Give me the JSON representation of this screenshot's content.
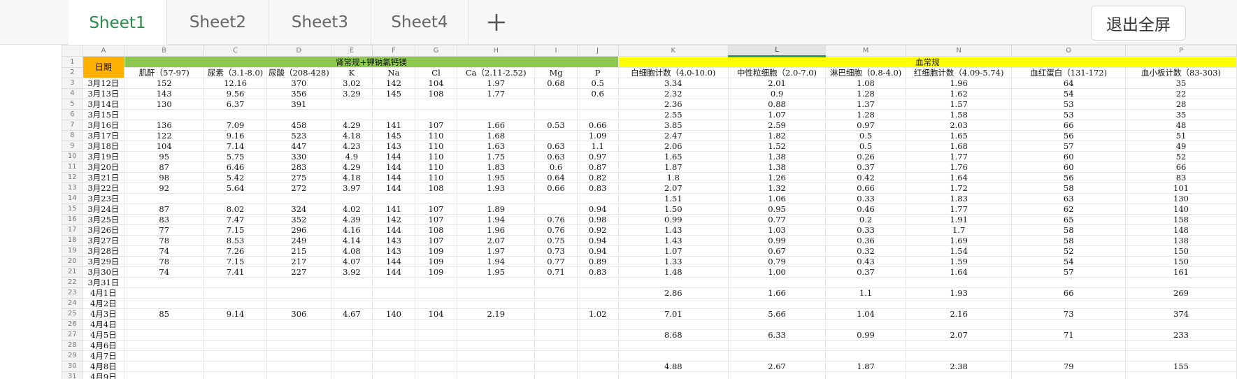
{
  "tabs": [
    {
      "label": "Sheet1",
      "active": true
    },
    {
      "label": "Sheet2",
      "active": false
    },
    {
      "label": "Sheet3",
      "active": false
    },
    {
      "label": "Sheet4",
      "active": false
    }
  ],
  "add_tab_icon": "plus-icon",
  "exit_fullscreen_label": "退出全屏",
  "accent_color": "#2a8a4a",
  "group_colors": {
    "kidney": "#8dc84f",
    "blood": "#ffff00",
    "date": "#ffb000"
  },
  "columns": [
    "A",
    "B",
    "C",
    "D",
    "E",
    "F",
    "G",
    "H",
    "I",
    "J",
    "K",
    "L",
    "M",
    "N",
    "O",
    "P"
  ],
  "selected_column": "L",
  "row1": {
    "date_label": "日期",
    "kidney_group": "肾常规+钾钠氯钙镁",
    "blood_group": "血常规"
  },
  "row2_headers": [
    "肌酐（57-97)",
    "尿素（3.1-8.0)",
    "尿酸（208-428)",
    "K",
    "Na",
    "Cl",
    "Ca（2.11-2.52)",
    "Mg",
    "P",
    "白细胞计数（4.0-10.0)",
    "中性粒细胞（2.0-7.0)",
    "淋巴细胞（0.8-4.0)",
    "红细胞计数（4.09-5.74)",
    "血红蛋白（131-172)",
    "血小板计数（83-303)"
  ],
  "rows": [
    {
      "num": "3",
      "cells": [
        "3月12日",
        "152",
        "12.16",
        "370",
        "3.02",
        "142",
        "104",
        "1.97",
        "0.68",
        "0.5",
        "3.34",
        "2.01",
        "1.08",
        "1.96",
        "64",
        "35"
      ]
    },
    {
      "num": "4",
      "cells": [
        "3月13日",
        "143",
        "9.56",
        "356",
        "3.29",
        "145",
        "108",
        "1.77",
        "",
        "0.6",
        "2.32",
        "0.9",
        "1.28",
        "1.62",
        "54",
        "22"
      ]
    },
    {
      "num": "5",
      "cells": [
        "3月14日",
        "130",
        "6.37",
        "391",
        "",
        "",
        "",
        "",
        "",
        "",
        "2.36",
        "0.88",
        "1.37",
        "1.57",
        "53",
        "28"
      ]
    },
    {
      "num": "6",
      "cells": [
        "3月15日",
        "",
        "",
        "",
        "",
        "",
        "",
        "",
        "",
        "",
        "2.55",
        "1.07",
        "1.28",
        "1.58",
        "53",
        "35"
      ]
    },
    {
      "num": "7",
      "cells": [
        "3月16日",
        "136",
        "7.09",
        "458",
        "4.29",
        "141",
        "107",
        "1.66",
        "0.53",
        "0.66",
        "3.85",
        "2.59",
        "0.97",
        "2.03",
        "66",
        "48"
      ]
    },
    {
      "num": "8",
      "cells": [
        "3月17日",
        "122",
        "9.16",
        "523",
        "4.18",
        "145",
        "110",
        "1.68",
        "",
        "1.09",
        "2.47",
        "1.82",
        "0.5",
        "1.65",
        "56",
        "51"
      ]
    },
    {
      "num": "9",
      "cells": [
        "3月18日",
        "104",
        "7.14",
        "447",
        "4.23",
        "143",
        "110",
        "1.63",
        "0.63",
        "1.1",
        "2.06",
        "1.52",
        "0.5",
        "1.68",
        "57",
        "49"
      ]
    },
    {
      "num": "10",
      "cells": [
        "3月19日",
        "95",
        "5.75",
        "330",
        "4.9",
        "144",
        "110",
        "1.75",
        "0.63",
        "0.97",
        "1.65",
        "1.38",
        "0.26",
        "1.77",
        "60",
        "52"
      ]
    },
    {
      "num": "11",
      "cells": [
        "3月20日",
        "87",
        "6.46",
        "283",
        "4.29",
        "144",
        "110",
        "1.83",
        "0.6",
        "0.87",
        "1.87",
        "1.38",
        "0.37",
        "1.76",
        "60",
        "66"
      ]
    },
    {
      "num": "12",
      "cells": [
        "3月21日",
        "98",
        "5.42",
        "275",
        "4.18",
        "144",
        "110",
        "1.95",
        "0.64",
        "0.82",
        "1.8",
        "1.26",
        "0.42",
        "1.64",
        "56",
        "83"
      ]
    },
    {
      "num": "13",
      "cells": [
        "3月22日",
        "92",
        "5.64",
        "272",
        "3.97",
        "144",
        "108",
        "1.93",
        "0.66",
        "0.83",
        "2.07",
        "1.32",
        "0.66",
        "1.72",
        "58",
        "101"
      ]
    },
    {
      "num": "14",
      "cells": [
        "3月23日",
        "",
        "",
        "",
        "",
        "",
        "",
        "",
        "",
        "",
        "1.51",
        "1.06",
        "0.33",
        "1.83",
        "63",
        "130"
      ]
    },
    {
      "num": "15",
      "cells": [
        "3月24日",
        "87",
        "8.02",
        "324",
        "4.02",
        "141",
        "107",
        "1.89",
        "",
        "0.94",
        "1.50",
        "0.95",
        "0.46",
        "1.77",
        "62",
        "140"
      ]
    },
    {
      "num": "16",
      "cells": [
        "3月25日",
        "83",
        "7.47",
        "352",
        "4.39",
        "142",
        "107",
        "1.94",
        "0.76",
        "0.98",
        "0.99",
        "0.77",
        "0.2",
        "1.91",
        "65",
        "158"
      ]
    },
    {
      "num": "17",
      "cells": [
        "3月26日",
        "77",
        "7.15",
        "296",
        "4.16",
        "144",
        "108",
        "1.96",
        "0.76",
        "0.92",
        "1.43",
        "1.03",
        "0.33",
        "1.7",
        "58",
        "148"
      ]
    },
    {
      "num": "18",
      "cells": [
        "3月27日",
        "78",
        "8.53",
        "249",
        "4.14",
        "143",
        "107",
        "2.07",
        "0.75",
        "0.94",
        "1.43",
        "0.99",
        "0.36",
        "1.69",
        "58",
        "138"
      ]
    },
    {
      "num": "19",
      "cells": [
        "3月28日",
        "74",
        "7.26",
        "215",
        "4.08",
        "143",
        "109",
        "1.97",
        "0.73",
        "0.94",
        "1.07",
        "0.67",
        "0.32",
        "1.54",
        "52",
        "150"
      ]
    },
    {
      "num": "20",
      "cells": [
        "3月29日",
        "78",
        "7.15",
        "217",
        "4.07",
        "144",
        "109",
        "1.94",
        "0.77",
        "0.89",
        "1.33",
        "0.79",
        "0.43",
        "1.59",
        "54",
        "150"
      ]
    },
    {
      "num": "21",
      "cells": [
        "3月30日",
        "74",
        "7.41",
        "227",
        "3.92",
        "144",
        "109",
        "1.95",
        "0.71",
        "0.83",
        "1.48",
        "1.00",
        "0.37",
        "1.64",
        "57",
        "161"
      ]
    },
    {
      "num": "22",
      "cells": [
        "3月31日",
        "",
        "",
        "",
        "",
        "",
        "",
        "",
        "",
        "",
        "",
        "",
        "",
        "",
        "",
        ""
      ]
    },
    {
      "num": "23",
      "cells": [
        "4月1日",
        "",
        "",
        "",
        "",
        "",
        "",
        "",
        "",
        "",
        "2.86",
        "1.66",
        "1.1",
        "1.93",
        "66",
        "269"
      ]
    },
    {
      "num": "24",
      "cells": [
        "4月2日",
        "",
        "",
        "",
        "",
        "",
        "",
        "",
        "",
        "",
        "",
        "",
        "",
        "",
        "",
        ""
      ]
    },
    {
      "num": "25",
      "cells": [
        "4月3日",
        "85",
        "9.14",
        "306",
        "4.67",
        "140",
        "104",
        "2.19",
        "",
        "1.02",
        "7.01",
        "5.66",
        "1.04",
        "2.16",
        "73",
        "374"
      ]
    },
    {
      "num": "26",
      "cells": [
        "4月4日",
        "",
        "",
        "",
        "",
        "",
        "",
        "",
        "",
        "",
        "",
        "",
        "",
        "",
        "",
        ""
      ]
    },
    {
      "num": "27",
      "cells": [
        "4月5日",
        "",
        "",
        "",
        "",
        "",
        "",
        "",
        "",
        "",
        "8.68",
        "6.33",
        "0.99",
        "2.07",
        "71",
        "233"
      ]
    },
    {
      "num": "28",
      "cells": [
        "4月6日",
        "",
        "",
        "",
        "",
        "",
        "",
        "",
        "",
        "",
        "",
        "",
        "",
        "",
        "",
        ""
      ]
    },
    {
      "num": "29",
      "cells": [
        "4月7日",
        "",
        "",
        "",
        "",
        "",
        "",
        "",
        "",
        "",
        "",
        "",
        "",
        "",
        "",
        ""
      ]
    },
    {
      "num": "30",
      "cells": [
        "4月8日",
        "",
        "",
        "",
        "",
        "",
        "",
        "",
        "",
        "",
        "4.88",
        "2.67",
        "1.87",
        "2.38",
        "79",
        "155"
      ]
    },
    {
      "num": "31",
      "cells": [
        "4月9日",
        "",
        "",
        "",
        "",
        "",
        "",
        "",
        "",
        "",
        "",
        "",
        "",
        "",
        "",
        ""
      ]
    }
  ]
}
